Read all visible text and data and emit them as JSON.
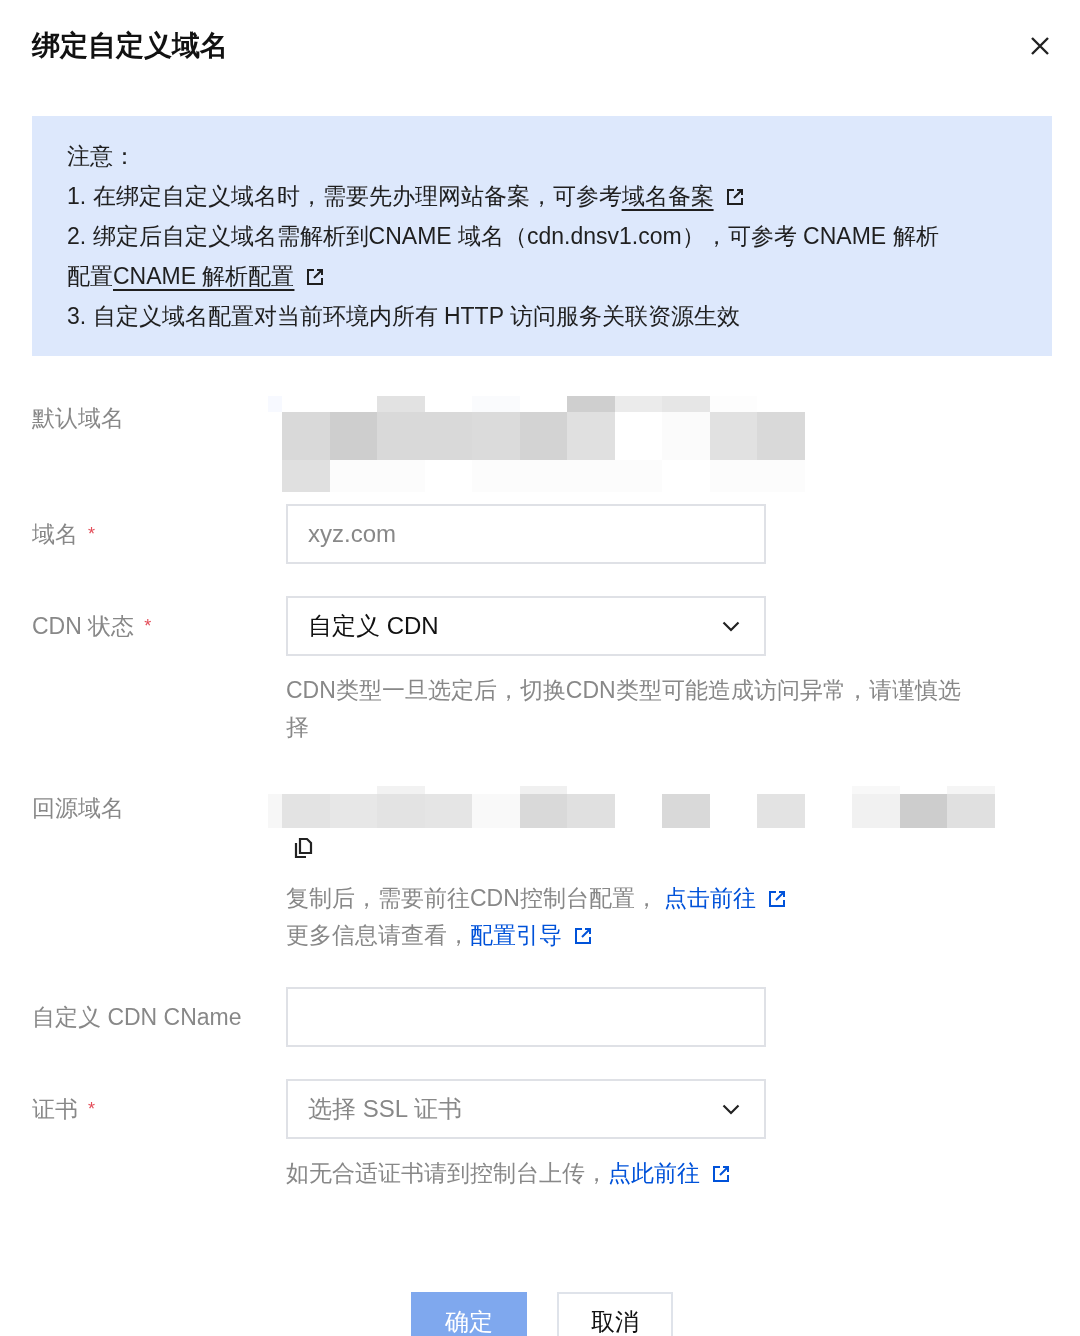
{
  "dialog": {
    "title": "绑定自定义域名"
  },
  "notice": {
    "heading": "注意：",
    "items": [
      {
        "text": "1. 在绑定自定义域名时，需要先办理网站备案，可参考",
        "link": "域名备案"
      },
      {
        "text": "2. 绑定后自定义域名需解析到CNAME 域名（cdn.dnsv1.com），可参考 CNAME 解析配置",
        "link": "CNAME 解析配置"
      },
      {
        "text": "3. 自定义域名配置对当前环境内所有 HTTP 访问服务关联资源生效"
      }
    ]
  },
  "form": {
    "rows": [
      {
        "kind": "masked",
        "label": "默认域名"
      },
      {
        "kind": "input",
        "label": "域名",
        "required_mark": "*",
        "placeholder": "xyz.com"
      },
      {
        "kind": "select",
        "label": "CDN 状态",
        "required_mark": "*",
        "value": "自定义 CDN",
        "help": [
          {
            "text": "CDN类型一旦选定后，切换CDN类型可能造成访问异常，请谨慎选择"
          }
        ]
      },
      {
        "kind": "masked",
        "label": "回源域名",
        "copyable": true,
        "help": [
          {
            "text": "复制后，需要前往CDN控制台配置， ",
            "link": "点击前往"
          },
          {
            "text": "更多信息请查看，",
            "link": "配置引导"
          }
        ]
      },
      {
        "kind": "input",
        "label": "自定义 CDN CName"
      },
      {
        "kind": "select",
        "label": "证书",
        "required_mark": "*",
        "placeholder": "选择 SSL 证书",
        "help": [
          {
            "text": "如无合适证书请到控制台上传，",
            "link": "点此前往"
          }
        ]
      }
    ]
  },
  "buttons": [
    {
      "label": "确定",
      "kind": "primary",
      "disabled": true
    },
    {
      "label": "取消",
      "kind": "secondary",
      "disabled": false
    }
  ]
}
